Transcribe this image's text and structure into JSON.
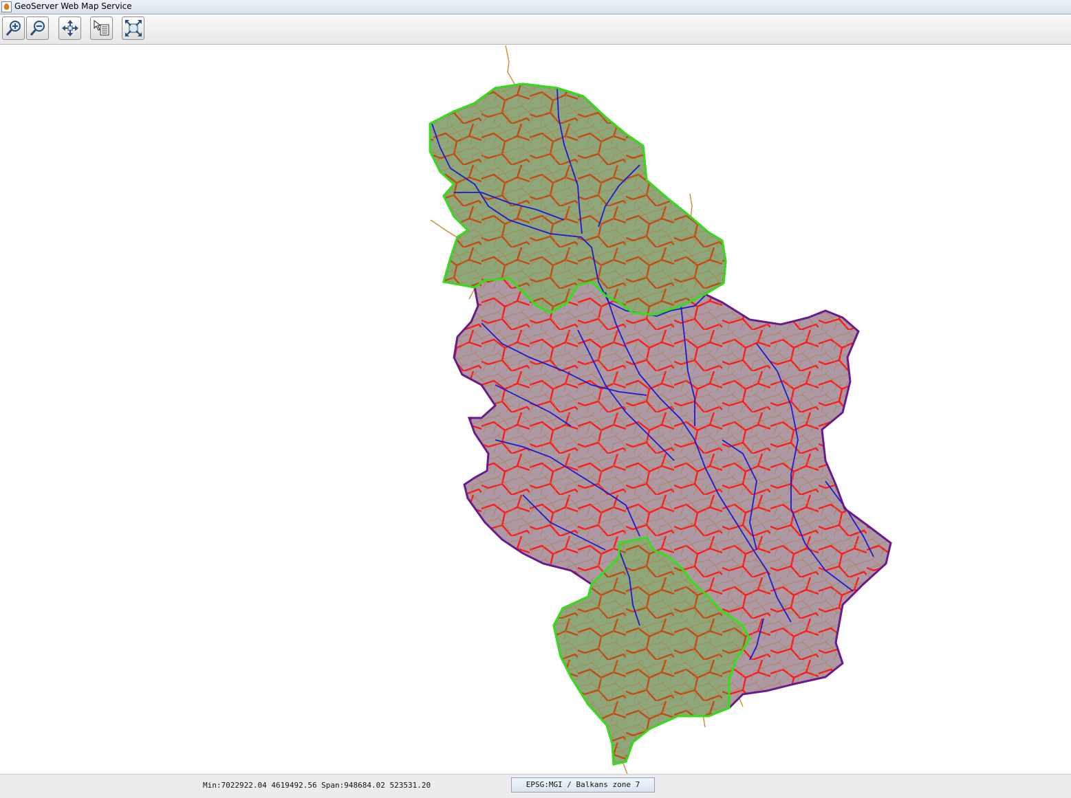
{
  "window": {
    "title": "GeoServer Web Map Service",
    "icon": "java-cup-icon"
  },
  "toolbar": {
    "buttons": [
      {
        "name": "zoom-in",
        "icon": "zoom-in-icon"
      },
      {
        "name": "zoom-out",
        "icon": "zoom-out-icon"
      },
      {
        "name": "pan",
        "icon": "pan-icon"
      },
      {
        "name": "info",
        "icon": "info-cursor-icon"
      },
      {
        "name": "reset",
        "icon": "reset-extent-icon"
      }
    ]
  },
  "map": {
    "colors": {
      "province_fill": "#8ea77a",
      "province_border": "#33e018",
      "country_fill": "#ad99a4",
      "country_border": "#6a1a8e",
      "major_rivers": "#1a1ad6",
      "district_borders": "#ff1a1a",
      "province_district_borders": "#c44a10",
      "roads": "#b07a3c"
    }
  },
  "status": {
    "extent": "Min:7022922.04 4619492.56 Span:948684.02 523531.20",
    "crs": "EPSG:MGI / Balkans zone 7"
  }
}
